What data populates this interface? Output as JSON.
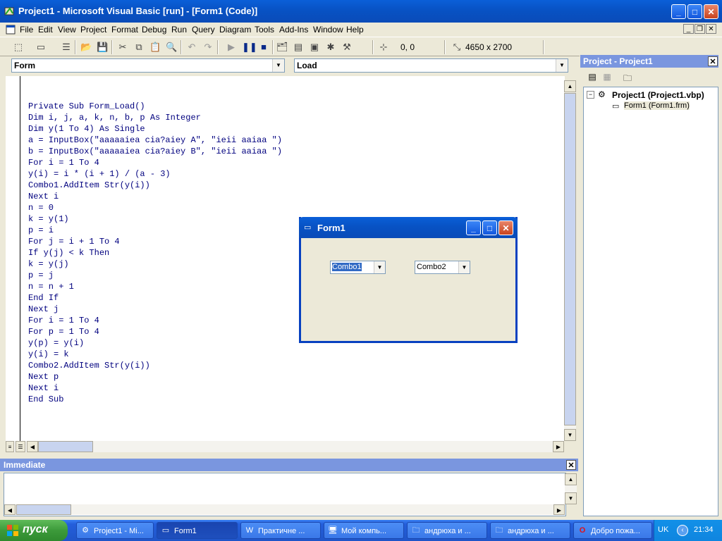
{
  "window": {
    "title": "Project1 - Microsoft Visual Basic [run] - [Form1 (Code)]"
  },
  "menu": {
    "items": [
      "File",
      "Edit",
      "View",
      "Project",
      "Format",
      "Debug",
      "Run",
      "Query",
      "Diagram",
      "Tools",
      "Add-Ins",
      "Window",
      "Help"
    ]
  },
  "toolbar": {
    "position": "0, 0",
    "size": "4650 x 2700"
  },
  "code_window": {
    "object_combo": "Form",
    "procedure_combo": "Load",
    "code": "Private Sub Form_Load()\nDim i, j, a, k, n, b, p As Integer\nDim y(1 To 4) As Single\na = InputBox(\"aaaaaiea cia?aiey A\", \"ieii aaiaa \")\nb = InputBox(\"aaaaaiea cia?aiey B\", \"ieii aaiaa \")\nFor i = 1 To 4\ny(i) = i * (i + 1) / (a - 3)\nCombo1.AddItem Str(y(i))\nNext i\nn = 0\nk = y(1)\np = i\nFor j = i + 1 To 4\nIf y(j) < k Then\nk = y(j)\np = j\nn = n + 1\nEnd If\nNext j\nFor i = 1 To 4\nFor p = 1 To 4\ny(p) = y(i)\ny(i) = k\nCombo2.AddItem Str(y(i))\nNext p\nNext i\nEnd Sub"
  },
  "immediate": {
    "title": "Immediate"
  },
  "project": {
    "title": "Project - Project1",
    "root": "Project1 (Project1.vbp)",
    "child": "Form1 (Form1.frm)"
  },
  "form1": {
    "title": "Form1",
    "combo1": "Combo1",
    "combo2": "Combo2"
  },
  "taskbar": {
    "start_label": "пуск",
    "tasks": [
      "Project1 - Mi...",
      "Form1",
      "Практичне ...",
      "Мой компь...",
      "андрюха и ...",
      "андрюха и ...",
      "Добро пожа..."
    ],
    "lang": "UK",
    "clock": "21:34"
  }
}
